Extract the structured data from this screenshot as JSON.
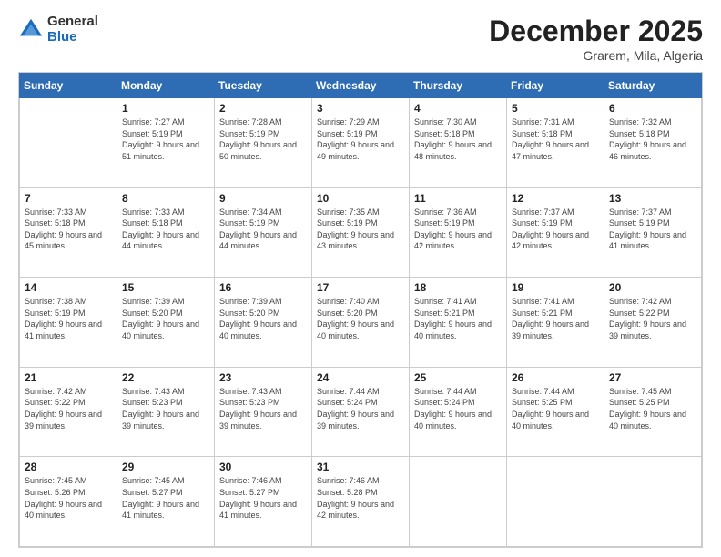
{
  "logo": {
    "general": "General",
    "blue": "Blue"
  },
  "title": "December 2025",
  "location": "Grarem, Mila, Algeria",
  "days_of_week": [
    "Sunday",
    "Monday",
    "Tuesday",
    "Wednesday",
    "Thursday",
    "Friday",
    "Saturday"
  ],
  "weeks": [
    [
      {
        "day": "",
        "sunrise": "",
        "sunset": "",
        "daylight": ""
      },
      {
        "day": "1",
        "sunrise": "Sunrise: 7:27 AM",
        "sunset": "Sunset: 5:19 PM",
        "daylight": "Daylight: 9 hours and 51 minutes."
      },
      {
        "day": "2",
        "sunrise": "Sunrise: 7:28 AM",
        "sunset": "Sunset: 5:19 PM",
        "daylight": "Daylight: 9 hours and 50 minutes."
      },
      {
        "day": "3",
        "sunrise": "Sunrise: 7:29 AM",
        "sunset": "Sunset: 5:19 PM",
        "daylight": "Daylight: 9 hours and 49 minutes."
      },
      {
        "day": "4",
        "sunrise": "Sunrise: 7:30 AM",
        "sunset": "Sunset: 5:18 PM",
        "daylight": "Daylight: 9 hours and 48 minutes."
      },
      {
        "day": "5",
        "sunrise": "Sunrise: 7:31 AM",
        "sunset": "Sunset: 5:18 PM",
        "daylight": "Daylight: 9 hours and 47 minutes."
      },
      {
        "day": "6",
        "sunrise": "Sunrise: 7:32 AM",
        "sunset": "Sunset: 5:18 PM",
        "daylight": "Daylight: 9 hours and 46 minutes."
      }
    ],
    [
      {
        "day": "7",
        "sunrise": "Sunrise: 7:33 AM",
        "sunset": "Sunset: 5:18 PM",
        "daylight": "Daylight: 9 hours and 45 minutes."
      },
      {
        "day": "8",
        "sunrise": "Sunrise: 7:33 AM",
        "sunset": "Sunset: 5:18 PM",
        "daylight": "Daylight: 9 hours and 44 minutes."
      },
      {
        "day": "9",
        "sunrise": "Sunrise: 7:34 AM",
        "sunset": "Sunset: 5:19 PM",
        "daylight": "Daylight: 9 hours and 44 minutes."
      },
      {
        "day": "10",
        "sunrise": "Sunrise: 7:35 AM",
        "sunset": "Sunset: 5:19 PM",
        "daylight": "Daylight: 9 hours and 43 minutes."
      },
      {
        "day": "11",
        "sunrise": "Sunrise: 7:36 AM",
        "sunset": "Sunset: 5:19 PM",
        "daylight": "Daylight: 9 hours and 42 minutes."
      },
      {
        "day": "12",
        "sunrise": "Sunrise: 7:37 AM",
        "sunset": "Sunset: 5:19 PM",
        "daylight": "Daylight: 9 hours and 42 minutes."
      },
      {
        "day": "13",
        "sunrise": "Sunrise: 7:37 AM",
        "sunset": "Sunset: 5:19 PM",
        "daylight": "Daylight: 9 hours and 41 minutes."
      }
    ],
    [
      {
        "day": "14",
        "sunrise": "Sunrise: 7:38 AM",
        "sunset": "Sunset: 5:19 PM",
        "daylight": "Daylight: 9 hours and 41 minutes."
      },
      {
        "day": "15",
        "sunrise": "Sunrise: 7:39 AM",
        "sunset": "Sunset: 5:20 PM",
        "daylight": "Daylight: 9 hours and 40 minutes."
      },
      {
        "day": "16",
        "sunrise": "Sunrise: 7:39 AM",
        "sunset": "Sunset: 5:20 PM",
        "daylight": "Daylight: 9 hours and 40 minutes."
      },
      {
        "day": "17",
        "sunrise": "Sunrise: 7:40 AM",
        "sunset": "Sunset: 5:20 PM",
        "daylight": "Daylight: 9 hours and 40 minutes."
      },
      {
        "day": "18",
        "sunrise": "Sunrise: 7:41 AM",
        "sunset": "Sunset: 5:21 PM",
        "daylight": "Daylight: 9 hours and 40 minutes."
      },
      {
        "day": "19",
        "sunrise": "Sunrise: 7:41 AM",
        "sunset": "Sunset: 5:21 PM",
        "daylight": "Daylight: 9 hours and 39 minutes."
      },
      {
        "day": "20",
        "sunrise": "Sunrise: 7:42 AM",
        "sunset": "Sunset: 5:22 PM",
        "daylight": "Daylight: 9 hours and 39 minutes."
      }
    ],
    [
      {
        "day": "21",
        "sunrise": "Sunrise: 7:42 AM",
        "sunset": "Sunset: 5:22 PM",
        "daylight": "Daylight: 9 hours and 39 minutes."
      },
      {
        "day": "22",
        "sunrise": "Sunrise: 7:43 AM",
        "sunset": "Sunset: 5:23 PM",
        "daylight": "Daylight: 9 hours and 39 minutes."
      },
      {
        "day": "23",
        "sunrise": "Sunrise: 7:43 AM",
        "sunset": "Sunset: 5:23 PM",
        "daylight": "Daylight: 9 hours and 39 minutes."
      },
      {
        "day": "24",
        "sunrise": "Sunrise: 7:44 AM",
        "sunset": "Sunset: 5:24 PM",
        "daylight": "Daylight: 9 hours and 39 minutes."
      },
      {
        "day": "25",
        "sunrise": "Sunrise: 7:44 AM",
        "sunset": "Sunset: 5:24 PM",
        "daylight": "Daylight: 9 hours and 40 minutes."
      },
      {
        "day": "26",
        "sunrise": "Sunrise: 7:44 AM",
        "sunset": "Sunset: 5:25 PM",
        "daylight": "Daylight: 9 hours and 40 minutes."
      },
      {
        "day": "27",
        "sunrise": "Sunrise: 7:45 AM",
        "sunset": "Sunset: 5:25 PM",
        "daylight": "Daylight: 9 hours and 40 minutes."
      }
    ],
    [
      {
        "day": "28",
        "sunrise": "Sunrise: 7:45 AM",
        "sunset": "Sunset: 5:26 PM",
        "daylight": "Daylight: 9 hours and 40 minutes."
      },
      {
        "day": "29",
        "sunrise": "Sunrise: 7:45 AM",
        "sunset": "Sunset: 5:27 PM",
        "daylight": "Daylight: 9 hours and 41 minutes."
      },
      {
        "day": "30",
        "sunrise": "Sunrise: 7:46 AM",
        "sunset": "Sunset: 5:27 PM",
        "daylight": "Daylight: 9 hours and 41 minutes."
      },
      {
        "day": "31",
        "sunrise": "Sunrise: 7:46 AM",
        "sunset": "Sunset: 5:28 PM",
        "daylight": "Daylight: 9 hours and 42 minutes."
      },
      {
        "day": "",
        "sunrise": "",
        "sunset": "",
        "daylight": ""
      },
      {
        "day": "",
        "sunrise": "",
        "sunset": "",
        "daylight": ""
      },
      {
        "day": "",
        "sunrise": "",
        "sunset": "",
        "daylight": ""
      }
    ]
  ]
}
